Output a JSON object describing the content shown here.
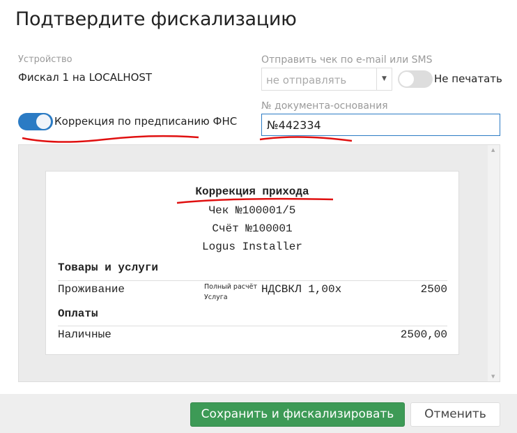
{
  "dialog": {
    "title": "Подтвердите фискализацию"
  },
  "device": {
    "label": "Устройство",
    "value": "Фискал 1 на LOCALHOST"
  },
  "send": {
    "label": "Отправить чек по e-mail или SMS",
    "placeholder": "не отправлять",
    "no_print_label": "Не печатать",
    "no_print_on": false
  },
  "correction": {
    "label": "Коррекция по предписанию ФНС",
    "on": true
  },
  "doc_number": {
    "label": "№ документа-основания",
    "value": "№442334"
  },
  "receipt": {
    "title": "Коррекция прихода",
    "check": "Чек №100001/5",
    "invoice": "Счёт №100001",
    "installer": "Logus Installer",
    "goods_header": "Товары и услуги",
    "item": {
      "name": "Проживание",
      "payment_type": "Полный расчёт",
      "subject": "Услуга",
      "vat_qty": "НДСВКЛ 1,00x",
      "amount": "2500"
    },
    "payments_header": "Оплаты",
    "payment": {
      "name": "Наличные",
      "amount": "2500,00"
    }
  },
  "footer": {
    "save_label": "Сохранить и фискализировать",
    "cancel_label": "Отменить"
  },
  "colors": {
    "accent": "#2b7bc4",
    "save": "#3d9a56",
    "annotation": "#e01010"
  }
}
